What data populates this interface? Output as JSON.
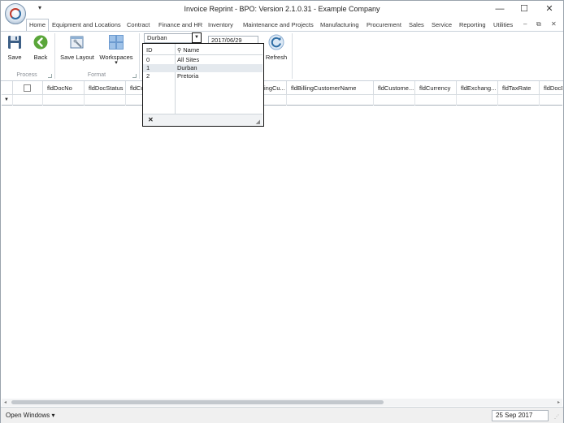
{
  "window": {
    "title": "Invoice Reprint - BPO: Version 2.1.0.31 - Example Company",
    "qat_arrow": "▾",
    "minimize": "—",
    "maximize": "☐",
    "close": "✕"
  },
  "tabs": {
    "items": [
      {
        "label": "Home"
      },
      {
        "label": "Equipment and Locations"
      },
      {
        "label": "Contract"
      },
      {
        "label": "Finance and HR"
      },
      {
        "label": "Inventory"
      },
      {
        "label": "Maintenance and Projects"
      },
      {
        "label": "Manufacturing"
      },
      {
        "label": "Procurement"
      },
      {
        "label": "Sales"
      },
      {
        "label": "Service"
      },
      {
        "label": "Reporting"
      },
      {
        "label": "Utilities"
      }
    ],
    "right_min": "–",
    "right_restore": "⧉",
    "right_close": "✕"
  },
  "ribbon": {
    "save": "Save",
    "back": "Back",
    "save_layout": "Save Layout",
    "workspaces": "Workspaces",
    "workspaces_arrow": "▾",
    "refresh": "Refresh",
    "groups": {
      "process": "Process",
      "format": "Format"
    },
    "site_value": "Durban",
    "date_value": "2017/06/29"
  },
  "site_dropdown": {
    "headers": {
      "id": "ID",
      "name": "Name"
    },
    "rows": [
      {
        "id": "0",
        "name": "All Sites"
      },
      {
        "id": "1",
        "name": "Durban"
      },
      {
        "id": "2",
        "name": "Pretoria"
      }
    ],
    "close_glyph": "✕"
  },
  "grid": {
    "columns": [
      {
        "label": "fldDocNo"
      },
      {
        "label": "fldDocStatus"
      },
      {
        "label": "fldCu"
      },
      {
        "label": "ingCu..."
      },
      {
        "label": "fldBillingCustomerName"
      },
      {
        "label": "fldCustome..."
      },
      {
        "label": "fldCurrency"
      },
      {
        "label": "fldExchang..."
      },
      {
        "label": "fldTaxRate"
      },
      {
        "label": "fldDocD"
      }
    ],
    "filter_indicator": "▼"
  },
  "statusbar": {
    "open_windows": "Open Windows",
    "open_windows_arrow": "▾",
    "date": "25 Sep 2017"
  },
  "colors": {
    "accent_blue": "#2e6da4",
    "back_green": "#5aa63a",
    "selection": "#e4e9ee"
  }
}
